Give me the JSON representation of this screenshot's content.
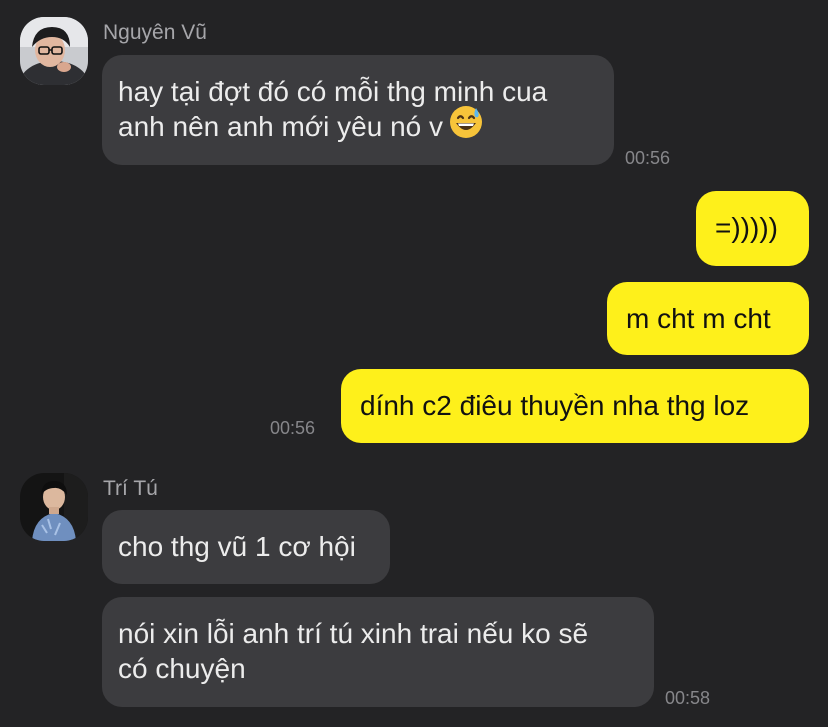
{
  "colors": {
    "background": "#232325",
    "incoming_bubble": "#3c3c3f",
    "outgoing_bubble": "#fef01b",
    "sender_name": "#a6a6aa",
    "timestamp": "#86868a"
  },
  "messages": {
    "nguyen_vu": {
      "sender": "Nguyên Vũ",
      "avatar_icon": "profile-photo-icon",
      "line1": "hay tại đợt đó có mỗi thg minh cua",
      "line2": "anh nên anh mới yêu nó v",
      "emoji_icon": "grinning-face-with-sweat-emoji",
      "time": "00:56"
    },
    "me": {
      "msg1": "=)))))",
      "msg2": "m cht m cht",
      "msg3": "dính c2 điêu thuyền nha thg loz",
      "time": "00:56"
    },
    "tri_tu": {
      "sender": "Trí Tú",
      "avatar_icon": "profile-photo-icon",
      "msg1": "cho thg vũ 1 cơ hội",
      "msg2_line1": "nói xin lỗi anh trí tú xinh trai nếu ko sẽ",
      "msg2_line2": "có chuyện",
      "time": "00:58"
    }
  }
}
